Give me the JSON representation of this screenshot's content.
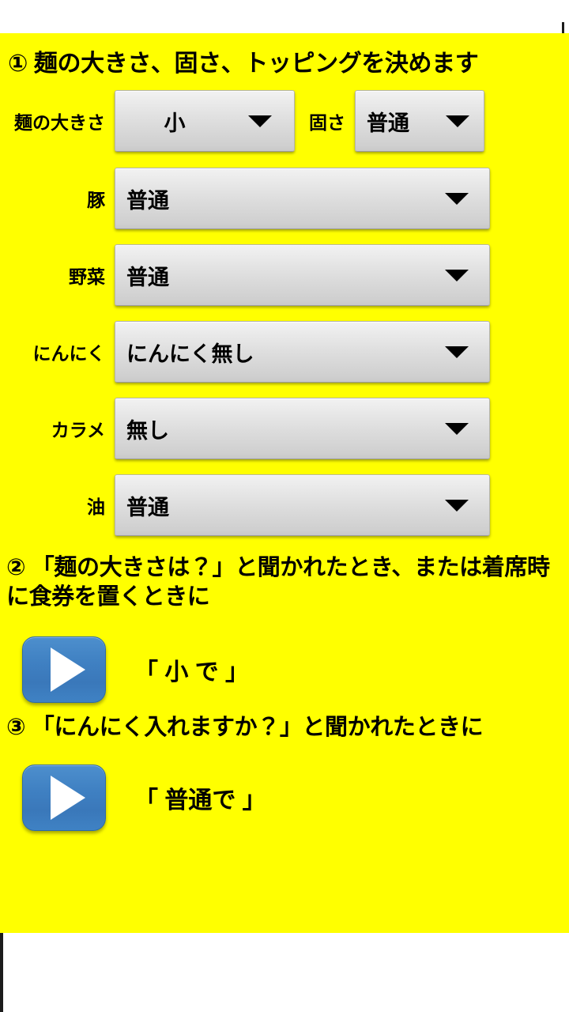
{
  "app": {
    "background_color": "#ffff00",
    "accent_color": "#3f80c2"
  },
  "sections": {
    "step1_heading": "① 麺の大きさ、固さ、トッピングを決めます",
    "step2_heading": "② 「麺の大きさは？」と聞かれたとき、または着席時に食券を置くときに",
    "step3_heading": "③ 「にんにく入れますか？」と聞かれたときに"
  },
  "options": {
    "noodle_size": {
      "label": "麺の大きさ",
      "value": "小"
    },
    "firmness": {
      "label": "固さ",
      "value": "普通"
    },
    "pork": {
      "label": "豚",
      "value": "普通"
    },
    "vegetables": {
      "label": "野菜",
      "value": "普通"
    },
    "garlic": {
      "label": "にんにく",
      "value": "にんにく無し"
    },
    "karame": {
      "label": "カラメ",
      "value": "無し"
    },
    "oil": {
      "label": "油",
      "value": "普通"
    }
  },
  "play_rows": [
    {
      "icon": "play-icon",
      "caption": "「 小 で 」"
    },
    {
      "icon": "play-icon",
      "caption": "「 普通で 」"
    }
  ]
}
